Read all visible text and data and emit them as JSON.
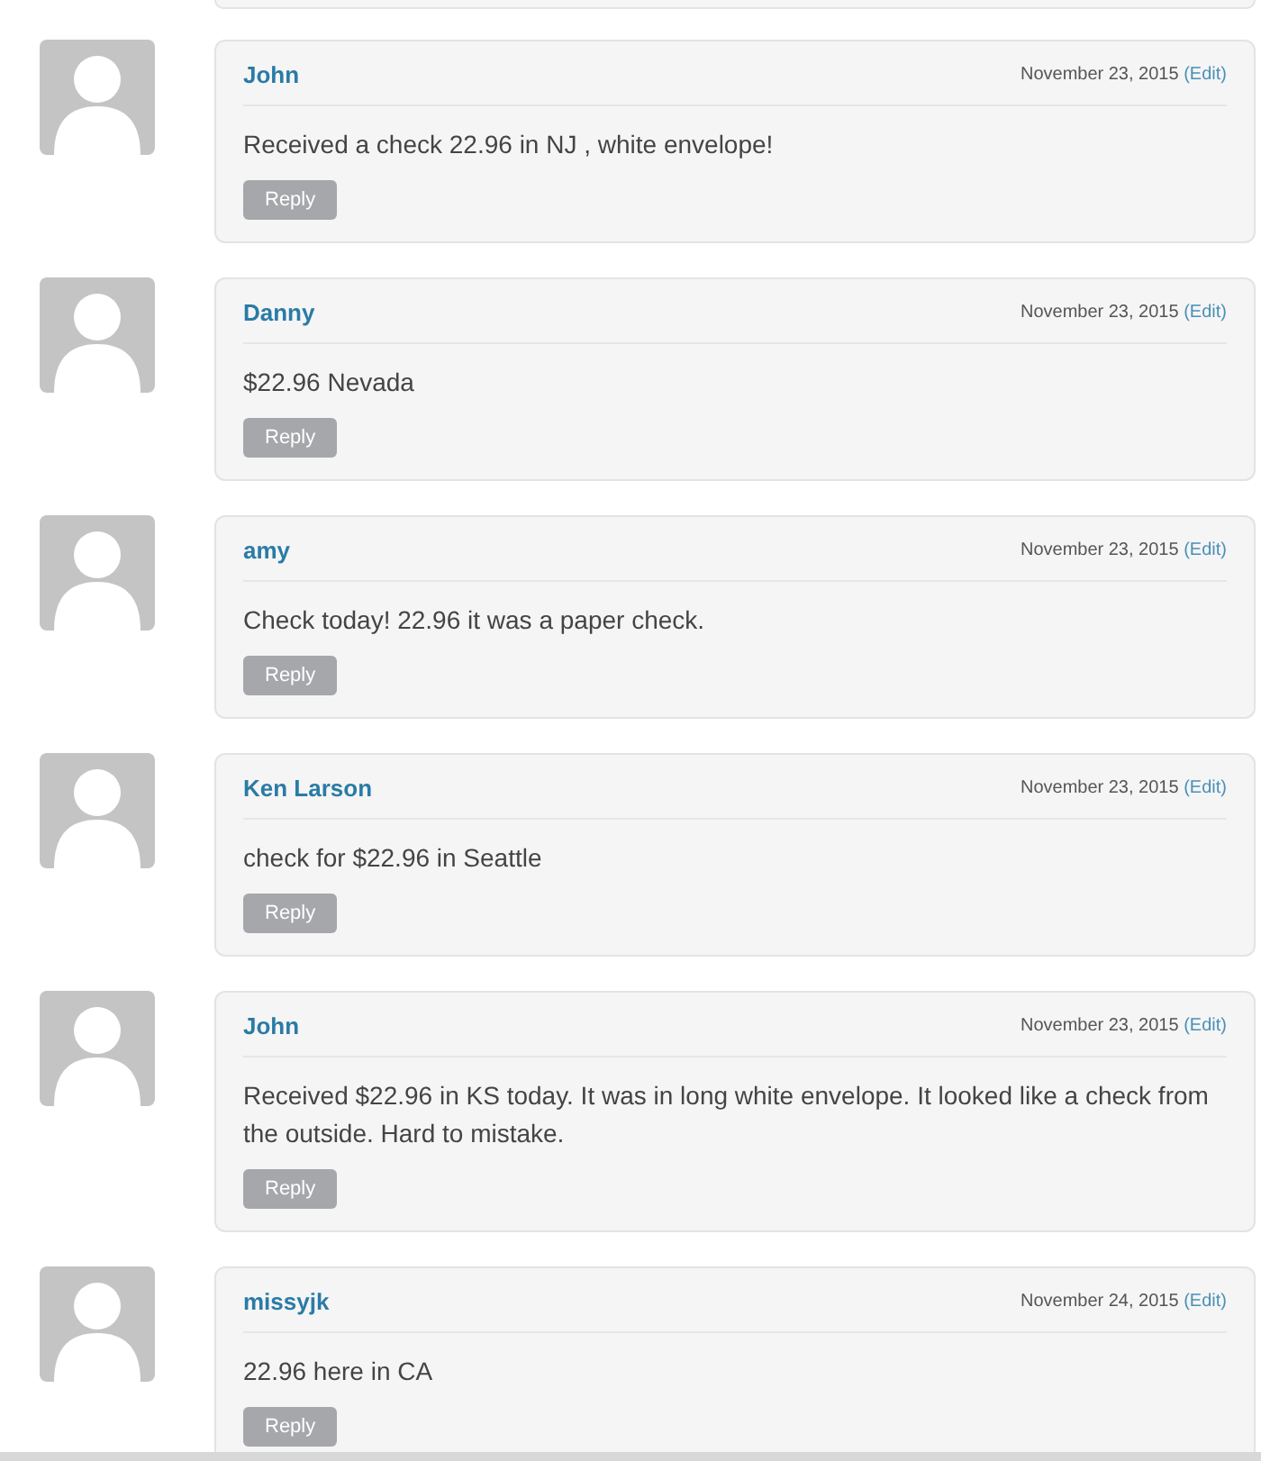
{
  "comments": [
    {
      "author": "John",
      "date": "November 23, 2015",
      "edit": "(Edit)",
      "text": "Received a check 22.96 in NJ , white envelope!",
      "reply": "Reply"
    },
    {
      "author": "Danny",
      "date": "November 23, 2015",
      "edit": "(Edit)",
      "text": "$22.96 Nevada",
      "reply": "Reply"
    },
    {
      "author": "amy",
      "date": "November 23, 2015",
      "edit": "(Edit)",
      "text": "Check today! 22.96 it was a paper check.",
      "reply": "Reply"
    },
    {
      "author": "Ken Larson",
      "date": "November 23, 2015",
      "edit": "(Edit)",
      "text": "check for $22.96 in Seattle",
      "reply": "Reply"
    },
    {
      "author": "John",
      "date": "November 23, 2015",
      "edit": "(Edit)",
      "text": "Received $22.96 in KS today. It was in long white envelope. It looked like a check from the outside. Hard to mistake.",
      "reply": "Reply"
    },
    {
      "author": "missyjk",
      "date": "November 24, 2015",
      "edit": "(Edit)",
      "text": "22.96 here in CA",
      "reply": "Reply"
    }
  ]
}
